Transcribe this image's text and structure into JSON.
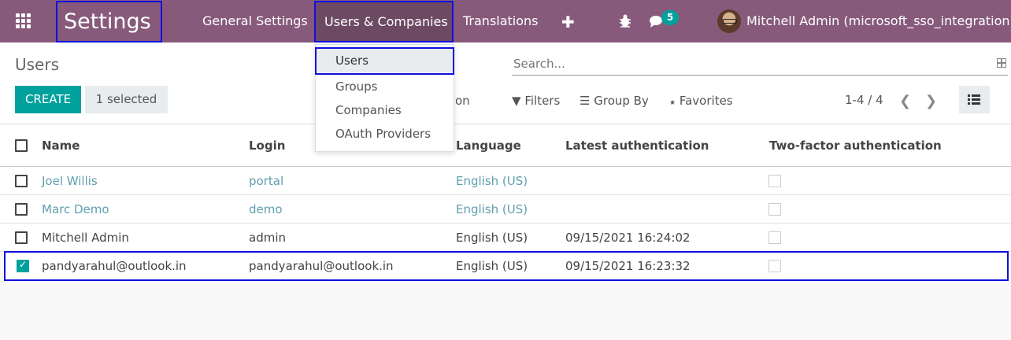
{
  "topbar": {
    "app_title": "Settings",
    "menus": [
      "General Settings",
      "Users & Companies",
      "Translations"
    ],
    "chat_badge": "5",
    "user_name": "Mitchell Admin (microsoft_sso_integration)",
    "bg_color": "#875a7b"
  },
  "dropdown": {
    "items": [
      "Users",
      "Groups",
      "Companies",
      "OAuth Providers"
    ],
    "active_item": "Users"
  },
  "control": {
    "breadcrumb": "Users",
    "create_label": "CREATE",
    "selected_label": "1 selected",
    "action_partial": "on",
    "search_placeholder": "Search...",
    "filters_label": "Filters",
    "groupby_label": "Group By",
    "favorites_label": "Favorites",
    "pager": "1-4 / 4"
  },
  "table": {
    "columns": [
      "Name",
      "Login",
      "Language",
      "Latest authentication",
      "Two-factor authentication"
    ],
    "rows": [
      {
        "name": "Joel Willis",
        "login": "portal",
        "language": "English (US)",
        "latest_auth": "",
        "selected": false,
        "link": true
      },
      {
        "name": "Marc Demo",
        "login": "demo",
        "language": "English (US)",
        "latest_auth": "",
        "selected": false,
        "link": true
      },
      {
        "name": "Mitchell Admin",
        "login": "admin",
        "language": "English (US)",
        "latest_auth": "09/15/2021 16:24:02",
        "selected": false,
        "link": false
      },
      {
        "name": "pandyarahul@outlook.in",
        "login": "pandyarahul@outlook.in",
        "language": "English (US)",
        "latest_auth": "09/15/2021 16:23:32",
        "selected": true,
        "link": false
      }
    ]
  },
  "colors": {
    "accent": "#00a09d",
    "highlight_border": "#1010e0",
    "link": "#5f9fb0"
  }
}
